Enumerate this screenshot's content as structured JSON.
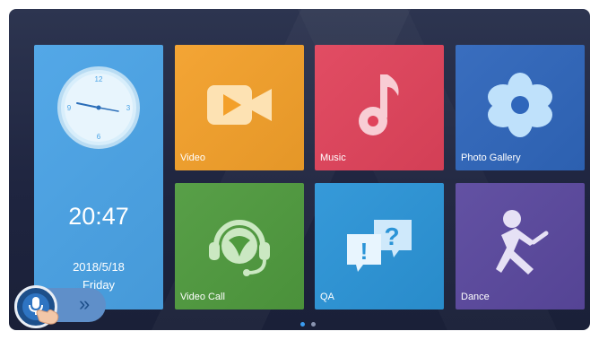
{
  "tiles": {
    "video": {
      "label": "Video",
      "color": "#f3a02a"
    },
    "music": {
      "label": "Music",
      "color": "#e0435b"
    },
    "photo": {
      "label": "Photo Gallery",
      "color": "#2f66bb"
    },
    "video_call": {
      "label": "Video Call",
      "color": "#4f9a3e"
    },
    "qa": {
      "label": "QA",
      "color": "#2b94d7"
    },
    "dance": {
      "label": "Dance",
      "color": "#5a489e"
    }
  },
  "clock": {
    "time": "20:47",
    "date": "2018/5/18",
    "day": "Friday",
    "dial_numbers": {
      "n12": "12",
      "n3": "3",
      "n6": "6",
      "n9": "9"
    },
    "color": "#4aa3e6"
  },
  "pager": {
    "pages": 2,
    "current": 1
  },
  "voice": {
    "chevron": "»",
    "icons": [
      "microphone-icon",
      "hand-pointer-icon"
    ]
  }
}
